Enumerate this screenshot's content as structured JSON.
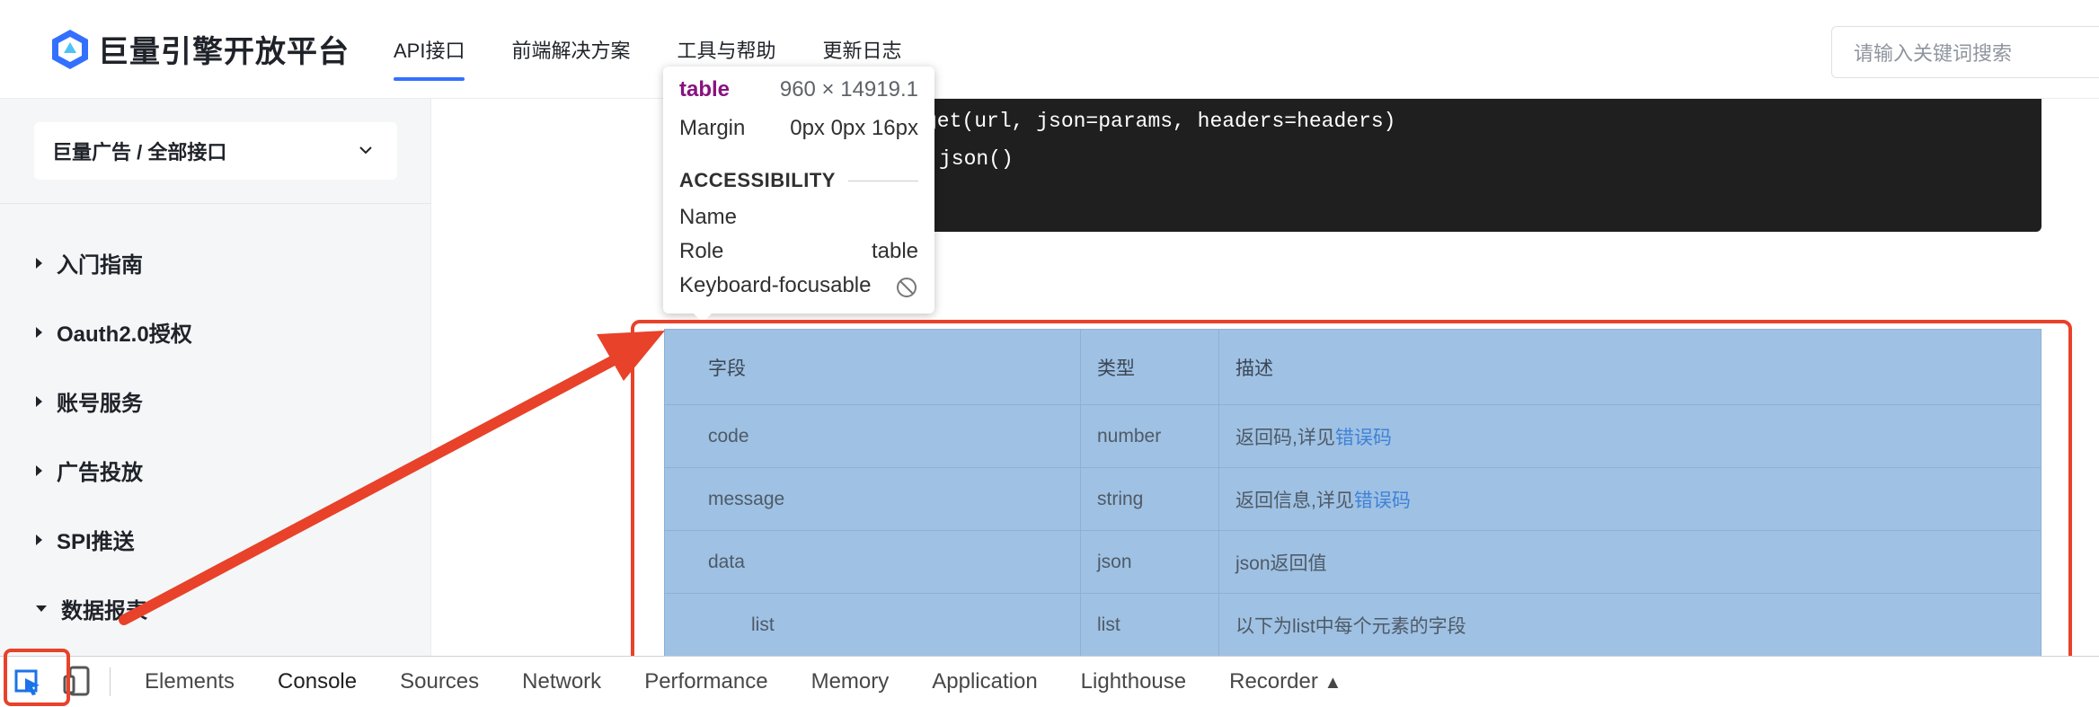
{
  "header": {
    "logo_text": "巨量引擎开放平台",
    "nav": [
      "API接口",
      "前端解决方案",
      "工具与帮助",
      "更新日志"
    ],
    "search_placeholder": "请输入关键词搜索"
  },
  "sidebar": {
    "selector_label": "巨量广告 / 全部接口",
    "items": [
      "入门指南",
      "Oauth2.0授权",
      "账号服务",
      "广告投放",
      "SPI推送",
      "数据报表"
    ]
  },
  "code": {
    "lines": [
      "get(url, json=params, headers=headers)",
      "json()"
    ]
  },
  "tooltip": {
    "tag": "table",
    "dimensions": "960 × 14919.1",
    "margin_label": "Margin",
    "margin_value": "0px 0px 16px",
    "section": "ACCESSIBILITY",
    "name_label": "Name",
    "role_label": "Role",
    "role_value": "table",
    "keyboard_label": "Keyboard-focusable"
  },
  "table": {
    "headers": [
      "字段",
      "类型",
      "描述"
    ],
    "rows": [
      {
        "field": "code",
        "type": "number",
        "desc": "返回码,详见",
        "link": "错误码"
      },
      {
        "field": "message",
        "type": "string",
        "desc": "返回信息,详见",
        "link": "错误码"
      },
      {
        "field": "data",
        "type": "json",
        "desc": "json返回值",
        "link": ""
      },
      {
        "field": "list",
        "type": "list",
        "desc": "以下为list中每个元素的字段",
        "link": ""
      }
    ]
  },
  "devtools": {
    "tabs": [
      "Elements",
      "Console",
      "Sources",
      "Network",
      "Performance",
      "Memory",
      "Application",
      "Lighthouse",
      "Recorder"
    ],
    "active_tab": "Console"
  },
  "colors": {
    "accent": "#3370ff",
    "highlight": "#e8422a",
    "table_highlight": "#9fc1e3"
  }
}
